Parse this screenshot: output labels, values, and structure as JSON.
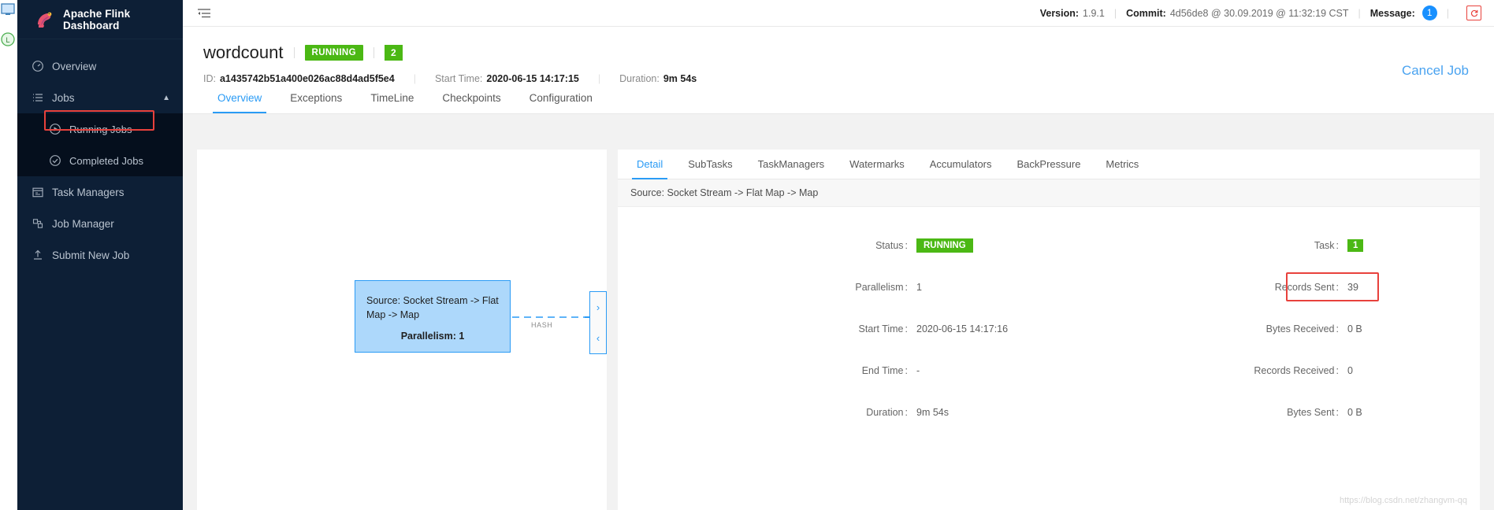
{
  "brand": {
    "title": "Apache Flink Dashboard",
    "logo_icon": "flink-squirrel-logo"
  },
  "sidebar": {
    "items": [
      {
        "label": "Overview",
        "icon": "gauge-icon"
      },
      {
        "label": "Jobs",
        "icon": "list-icon",
        "caret": "chevron-up-icon"
      },
      {
        "label": "Running Jobs",
        "icon": "play-circle-icon"
      },
      {
        "label": "Completed Jobs",
        "icon": "check-circle-icon"
      },
      {
        "label": "Task Managers",
        "icon": "calendar-icon"
      },
      {
        "label": "Job Manager",
        "icon": "server-icon"
      },
      {
        "label": "Submit New Job",
        "icon": "upload-icon"
      }
    ]
  },
  "topbar": {
    "collapse_icon": "menu-collapse-icon",
    "version_label": "Version:",
    "version_value": "1.9.1",
    "commit_label": "Commit:",
    "commit_value": "4d56de8 @ 30.09.2019 @ 11:32:19 CST",
    "message_label": "Message:",
    "message_count": "1",
    "refresh_icon": "refresh-icon"
  },
  "job": {
    "name": "wordcount",
    "status": "RUNNING",
    "task_count": "2",
    "id_label": "ID:",
    "id_value": "a1435742b51a400e026ac88d4ad5f5e4",
    "start_label": "Start Time:",
    "start_value": "2020-06-15 14:17:15",
    "duration_label": "Duration:",
    "duration_value": "9m 54s",
    "cancel_label": "Cancel Job"
  },
  "page_tabs": [
    {
      "label": "Overview",
      "active": true
    },
    {
      "label": "Exceptions",
      "active": false
    },
    {
      "label": "TimeLine",
      "active": false
    },
    {
      "label": "Checkpoints",
      "active": false
    },
    {
      "label": "Configuration",
      "active": false
    }
  ],
  "graph": {
    "node_label": "Source: Socket Stream -> Flat Map -> Map",
    "node_parallelism": "Parallelism: 1",
    "edge_label": "HASH",
    "expand_icon": "chevron-right-icon",
    "collapse_icon": "chevron-left-icon"
  },
  "detail": {
    "tabs": [
      {
        "label": "Detail",
        "active": true
      },
      {
        "label": "SubTasks",
        "active": false
      },
      {
        "label": "TaskManagers",
        "active": false
      },
      {
        "label": "Watermarks",
        "active": false
      },
      {
        "label": "Accumulators",
        "active": false
      },
      {
        "label": "BackPressure",
        "active": false
      },
      {
        "label": "Metrics",
        "active": false
      }
    ],
    "breadcrumb": "Source: Socket Stream -> Flat Map -> Map",
    "fields": [
      {
        "key": "Status",
        "value": "RUNNING",
        "kind": "tag"
      },
      {
        "key": "Task",
        "value": "1",
        "kind": "tagnum"
      },
      {
        "key": "Parallelism",
        "value": "1",
        "kind": "text"
      },
      {
        "key": "Records Sent",
        "value": "39",
        "kind": "text",
        "highlight": true
      },
      {
        "key": "Start Time",
        "value": "2020-06-15 14:17:16",
        "kind": "text"
      },
      {
        "key": "Bytes Received",
        "value": "0 B",
        "kind": "text"
      },
      {
        "key": "End Time",
        "value": "-",
        "kind": "text"
      },
      {
        "key": "Records Received",
        "value": "0",
        "kind": "text"
      },
      {
        "key": "Duration",
        "value": "9m 54s",
        "kind": "text"
      },
      {
        "key": "Bytes Sent",
        "value": "0 B",
        "kind": "text"
      }
    ]
  },
  "watermark": "https://blog.csdn.net/zhangvm-qq",
  "colors": {
    "sidebar_bg": "#0d1f36",
    "accent_blue": "#2a9bf5",
    "status_green": "#4bb814",
    "highlight_red": "#e8413c",
    "badge_blue": "#1890ff"
  }
}
